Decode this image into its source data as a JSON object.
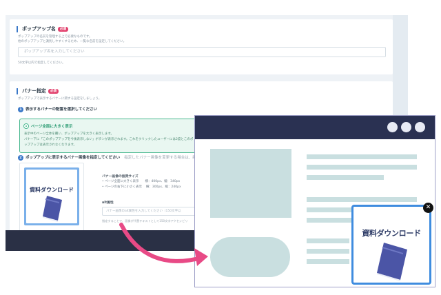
{
  "form": {
    "popup_name": {
      "label": "ポップアップ名",
      "required_badge": "必須",
      "desc_1": "ポップアップの名前を管理する上で必要なものです。",
      "desc_2": "他のポップアップと識別しやすくするため、一覧な名前を設定してください。",
      "placeholder": "ポップアップ名を入力してください",
      "hint": "50文字以内で指定してください。"
    },
    "banner": {
      "label": "バナー指定",
      "required_badge": "必須",
      "desc": "ポップアップで表示するバナーに関する設定をしましょう。",
      "step1_num": "1",
      "step1_label": "表示するバナーの配置を選択してください",
      "option_title": "ページ全面に大きく表示",
      "option_line_1": "表示中のページ全体を覆い、ポップアップを大きく表示します。",
      "option_line_2": "バナー下に「このポップアップを今後表示しない」ボタンが表示されます。これをクリックしたユーザーには2度とこのポ",
      "option_line_3": "ップアップは表示されなくなります。",
      "step2_num": "2",
      "step2_label": "ポップアップに表示するバナー画像を指定してください",
      "step2_note": "指定したバナー画像を変更する場合は、画像をクリ",
      "thumb_text": "資料ダウンロード",
      "spec_title": "バナー画像の推奨サイズ",
      "spec_line_1": "• ページ全面に大きく表示　　横：400px、縦：340px",
      "spec_line_2": "• ページの右下に小さく表示　 横：300px、縦：240px",
      "alt_label": "alt属性",
      "alt_placeholder": "バナー画像のalt属性を入力してください（150文字以",
      "alt_note": "指定することで、画像が代替テキストとして150文字アクセシビリ"
    }
  },
  "preview": {
    "popup_text": "資料ダウンロード",
    "close_symbol": "✕"
  },
  "colors": {
    "accent": "#3a78c8",
    "required": "#e2426e",
    "option_green": "#47b88e",
    "arrow_pink": "#e84a86",
    "browser_bar": "#2a3152",
    "popup_border": "#3f8cdf",
    "placeholder_block": "#c9dfe0",
    "book": "#4b55a6"
  }
}
